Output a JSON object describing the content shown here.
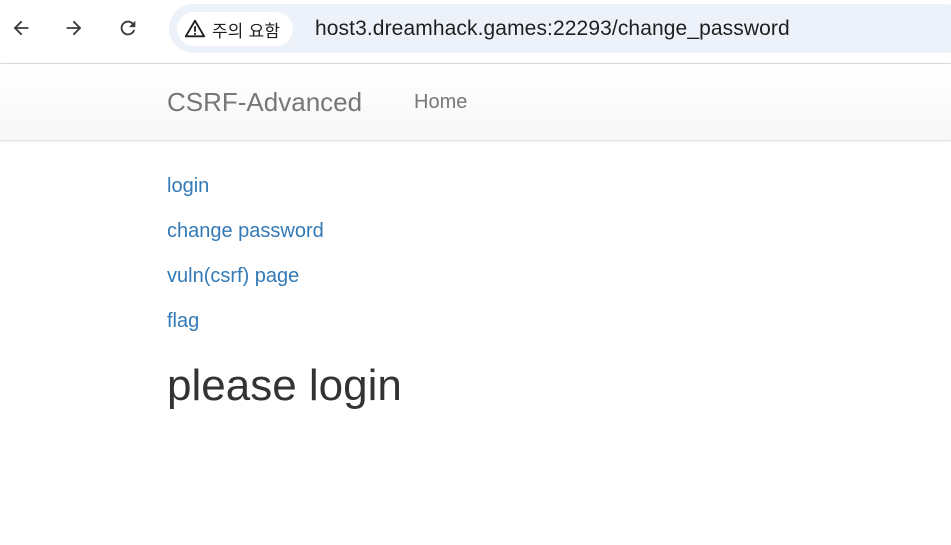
{
  "browser": {
    "security_label": "주의 요함",
    "url": "host3.dreamhack.games:22293/change_password",
    "icons": {
      "back": "arrow-left-icon",
      "forward": "arrow-right-icon",
      "reload": "reload-icon",
      "warning": "warning-triangle-icon"
    }
  },
  "navbar": {
    "brand": "CSRF-Advanced",
    "home": "Home"
  },
  "links": [
    {
      "label": "login"
    },
    {
      "label": "change password"
    },
    {
      "label": "vuln(csrf) page"
    },
    {
      "label": "flag"
    }
  ],
  "main": {
    "heading": "please login"
  },
  "colors": {
    "link": "#337ab7",
    "heading": "#333333",
    "navbar_text": "#777777",
    "omnibox_bg": "#edf2fa"
  }
}
